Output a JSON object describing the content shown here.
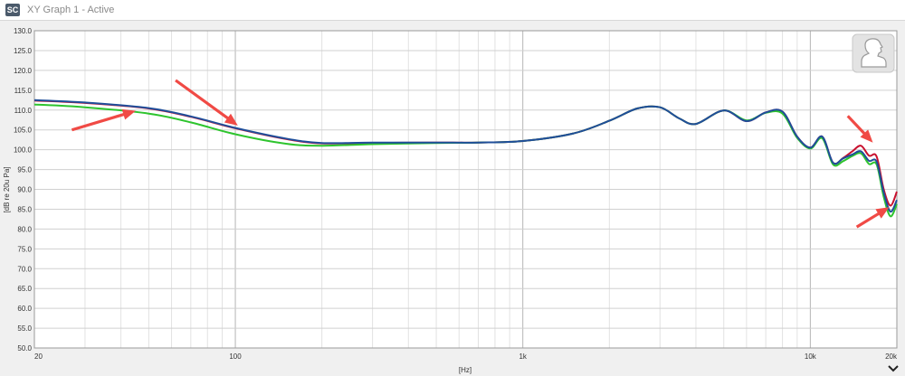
{
  "window": {
    "title": "XY Graph 1 - Active",
    "app_icon": "SC"
  },
  "colors": {
    "red": "#c8102e",
    "green": "#2ec42e",
    "dark_green": "#1f7a3a",
    "blue": "#1f4e9a",
    "arrow": "#f04a45"
  },
  "chart_data": {
    "type": "line",
    "xscale": "log",
    "xlim": [
      20,
      20000
    ],
    "ylim": [
      50,
      130
    ],
    "xlabel": "[Hz]",
    "ylabel": "[dB re 20u Pa]",
    "grid": true,
    "x_ticks": [
      "20",
      "100",
      "1k",
      "10k",
      "20k"
    ],
    "y_ticks": [
      "50.0",
      "55.0",
      "60.0",
      "65.0",
      "70.0",
      "75.0",
      "80.0",
      "85.0",
      "90.0",
      "95.0",
      "100.0",
      "105.0",
      "110.0",
      "115.0",
      "120.0",
      "125.0",
      "130.0"
    ],
    "series": [
      {
        "color": "#c8102e",
        "x": [
          20,
          30,
          50,
          70,
          100,
          150,
          200,
          300,
          500,
          700,
          1000,
          1500,
          2000,
          2500,
          3000,
          3500,
          4000,
          5000,
          6000,
          7000,
          8000,
          9000,
          10000,
          11000,
          12000,
          13000,
          14000,
          15000,
          16000,
          17000,
          18000,
          19000,
          20000
        ],
        "y": [
          112.4,
          111.8,
          110.4,
          108.3,
          105.4,
          102.7,
          101.6,
          101.7,
          101.8,
          101.8,
          102.2,
          104.1,
          107.3,
          110.4,
          110.7,
          107.9,
          106.5,
          109.9,
          107.2,
          109.4,
          109.6,
          103.3,
          100.5,
          103.3,
          96.7,
          97.9,
          99.6,
          101.0,
          98.5,
          98.3,
          90.0,
          85.9,
          89.4
        ]
      },
      {
        "color": "#2ec42e",
        "x": [
          20,
          30,
          50,
          70,
          100,
          150,
          200,
          300,
          500,
          700,
          1000,
          1500,
          2000,
          2500,
          3000,
          3500,
          4000,
          5000,
          6000,
          7000,
          8000,
          9000,
          10000,
          11000,
          12000,
          13000,
          14000,
          15000,
          16000,
          17000,
          18000,
          19000,
          20000
        ],
        "y": [
          111.4,
          110.7,
          109.1,
          106.9,
          103.9,
          101.5,
          101.0,
          101.4,
          101.7,
          101.8,
          102.2,
          104.1,
          107.3,
          110.4,
          110.7,
          107.9,
          106.5,
          109.9,
          107.4,
          109.3,
          109.1,
          103.0,
          100.3,
          102.9,
          96.3,
          97.1,
          98.4,
          99.1,
          96.4,
          96.3,
          88.1,
          83.2,
          86.3
        ]
      },
      {
        "color": "#1f4e9a",
        "x": [
          20,
          30,
          50,
          70,
          100,
          150,
          200,
          300,
          500,
          700,
          1000,
          1500,
          2000,
          2500,
          3000,
          3500,
          4000,
          5000,
          6000,
          7000,
          8000,
          9000,
          10000,
          11000,
          12000,
          13000,
          14000,
          15000,
          16000,
          17000,
          18000,
          19000,
          20000
        ],
        "y": [
          112.5,
          111.9,
          110.5,
          108.4,
          105.5,
          102.8,
          101.7,
          101.8,
          101.8,
          101.8,
          102.2,
          104.1,
          107.3,
          110.4,
          110.7,
          107.9,
          106.5,
          109.9,
          107.2,
          109.4,
          109.6,
          103.3,
          100.5,
          103.3,
          96.7,
          97.8,
          98.8,
          99.6,
          97.2,
          97.0,
          89.2,
          84.4,
          87.3
        ]
      }
    ],
    "annotations": [
      {
        "type": "arrow",
        "color": "#f04a45",
        "from": [
          27,
          105
        ],
        "to": [
          45,
          109.8
        ]
      },
      {
        "type": "arrow",
        "color": "#f04a45",
        "from": [
          62,
          117.5
        ],
        "to": [
          102,
          106.1
        ]
      },
      {
        "type": "arrow",
        "color": "#f04a45",
        "from": [
          13500,
          108.5
        ],
        "to": [
          16500,
          101.8
        ]
      },
      {
        "type": "arrow",
        "color": "#f04a45",
        "from": [
          14500,
          80.5
        ],
        "to": [
          18800,
          85.5
        ]
      }
    ]
  }
}
